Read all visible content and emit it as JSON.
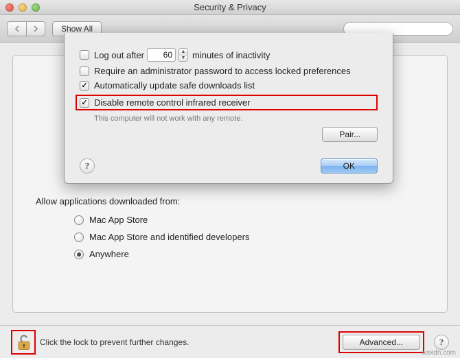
{
  "window": {
    "title": "Security & Privacy"
  },
  "toolbar": {
    "show_all": "Show All",
    "search_placeholder": ""
  },
  "sheet": {
    "logout_label_prefix": "Log out after",
    "logout_minutes": "60",
    "logout_label_suffix": "minutes of inactivity",
    "require_admin": "Require an administrator password to access locked preferences",
    "auto_update": "Automatically update safe downloads list",
    "disable_ir": "Disable remote control infrared receiver",
    "ir_hint": "This computer will not work with any remote.",
    "pair_button": "Pair...",
    "ok_button": "OK"
  },
  "allow": {
    "title": "Allow applications downloaded from:",
    "options": [
      {
        "label": "Mac App Store",
        "selected": false
      },
      {
        "label": "Mac App Store and identified developers",
        "selected": false
      },
      {
        "label": "Anywhere",
        "selected": true
      }
    ]
  },
  "footer": {
    "lock_text": "Click the lock to prevent further changes.",
    "advanced": "Advanced..."
  },
  "watermark": "wsxdn.com"
}
